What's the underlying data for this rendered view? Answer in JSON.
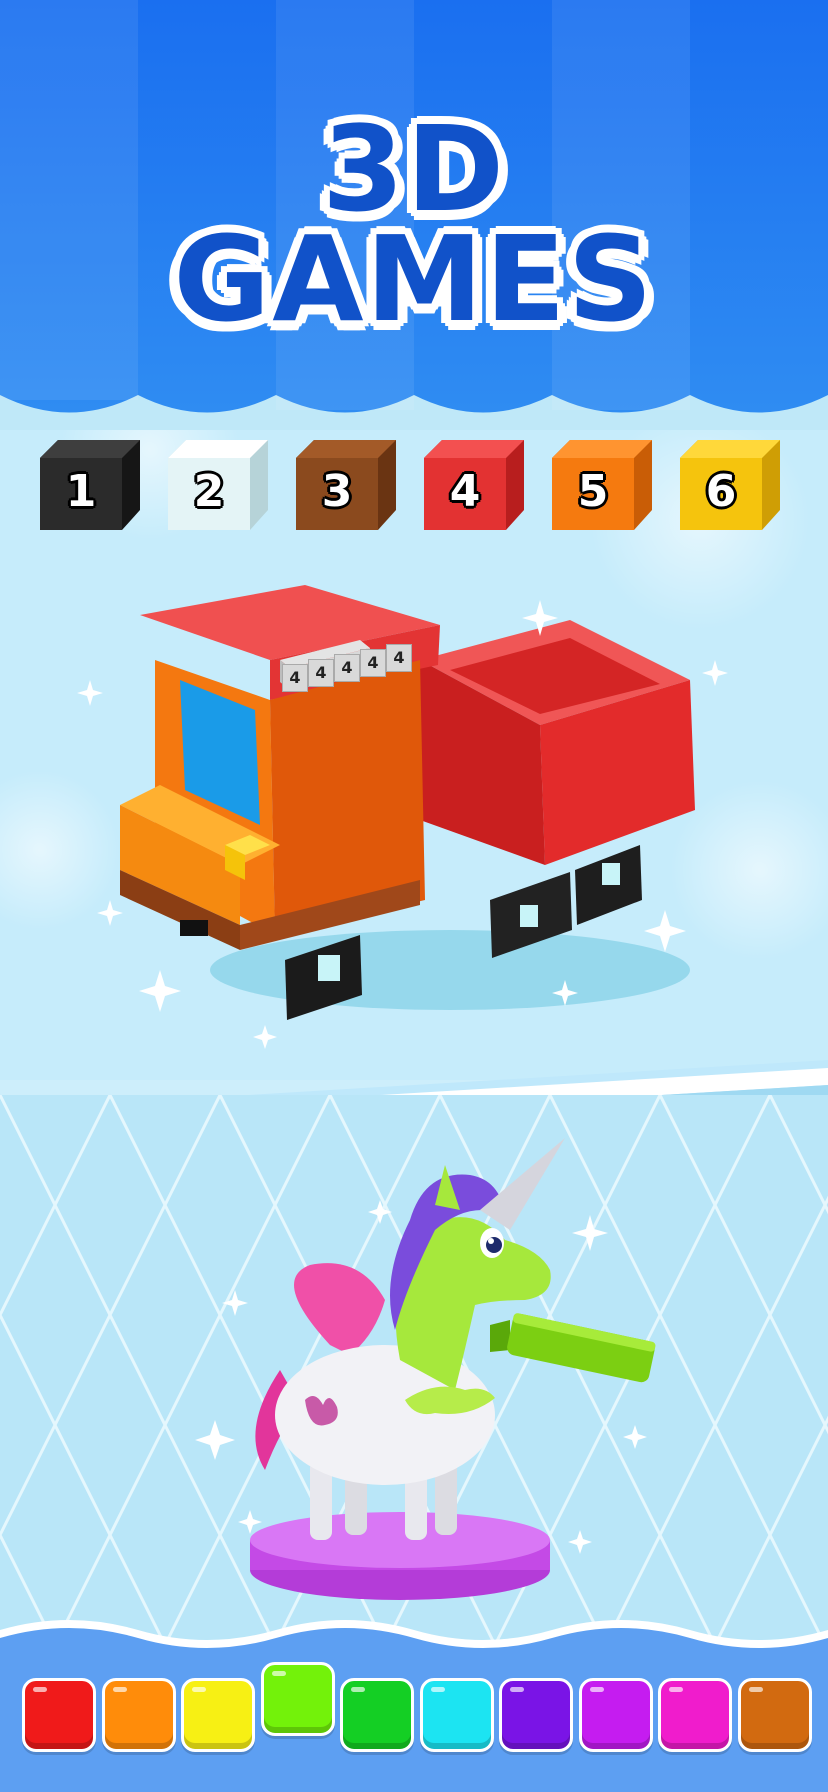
{
  "title": {
    "line1": "3D",
    "line2": "GAMES"
  },
  "palette": [
    {
      "number": "1",
      "color": "#2b2b2b",
      "dark": "#161616",
      "light": "#3e3e3e"
    },
    {
      "number": "2",
      "color": "#e4f4f6",
      "dark": "#b6d3d8",
      "light": "#ffffff"
    },
    {
      "number": "3",
      "color": "#8b4a1e",
      "dark": "#6a3412",
      "light": "#a35a28"
    },
    {
      "number": "4",
      "color": "#e33232",
      "dark": "#b81e1e",
      "light": "#f35050"
    },
    {
      "number": "5",
      "color": "#f57a0f",
      "dark": "#c95d06",
      "light": "#ff9430"
    },
    {
      "number": "6",
      "color": "#f5c40d",
      "dark": "#cf9e05",
      "light": "#ffd83a"
    }
  ],
  "truck_label_cubes": [
    "4",
    "4",
    "4",
    "4",
    "4"
  ],
  "bottom_colors": [
    {
      "name": "red",
      "color": "#f01a1a"
    },
    {
      "name": "orange",
      "color": "#ff8c0a"
    },
    {
      "name": "yellow",
      "color": "#f7f014"
    },
    {
      "name": "lime",
      "color": "#73f20a"
    },
    {
      "name": "green",
      "color": "#14cf24"
    },
    {
      "name": "cyan",
      "color": "#1ce4f2"
    },
    {
      "name": "purple",
      "color": "#7a14e6"
    },
    {
      "name": "violet",
      "color": "#c51cf0"
    },
    {
      "name": "magenta",
      "color": "#f01ccc"
    },
    {
      "name": "brown",
      "color": "#d26a10"
    }
  ]
}
